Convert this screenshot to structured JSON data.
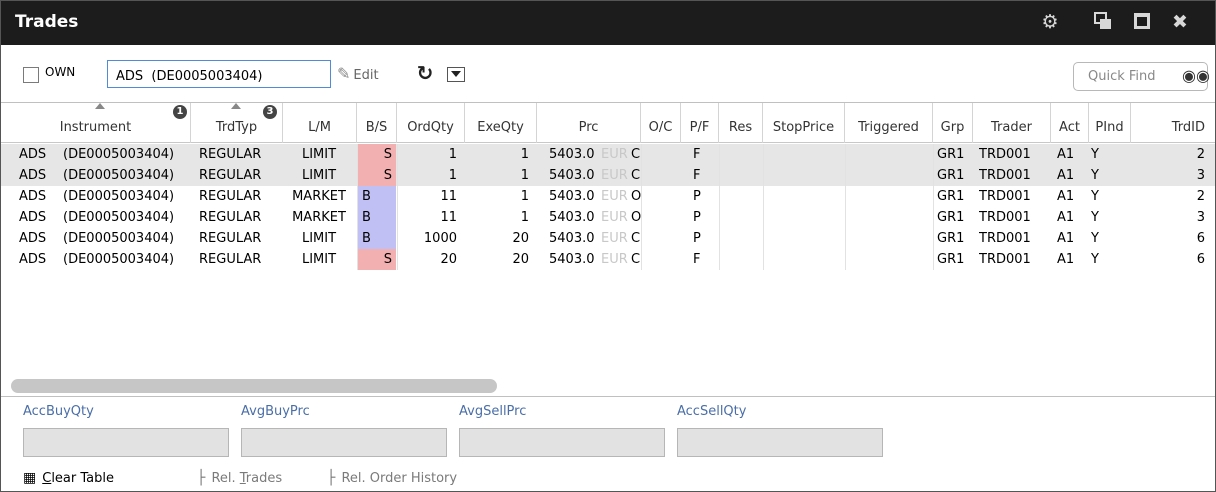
{
  "window": {
    "title": "Trades",
    "icons": [
      "gear-icon",
      "detach-icon",
      "maximize-icon",
      "close-icon"
    ]
  },
  "toolbar": {
    "own_label": "OWN",
    "own_checked": false,
    "instrument_value": "ADS  (DE0005003404)",
    "edit_label": "Edit",
    "quickfind_placeholder": "Quick Find"
  },
  "columns": [
    {
      "label": "Instrument",
      "sort": "asc",
      "sort_order": "1"
    },
    {
      "label": "TrdTyp",
      "sort": "asc",
      "sort_order": "3"
    },
    {
      "label": "L/M"
    },
    {
      "label": "B/S"
    },
    {
      "label": "OrdQty"
    },
    {
      "label": "ExeQty"
    },
    {
      "label": "Prc"
    },
    {
      "label": "O/C"
    },
    {
      "label": "P/F"
    },
    {
      "label": "Res"
    },
    {
      "label": "StopPrice"
    },
    {
      "label": "Triggered"
    },
    {
      "label": "Grp"
    },
    {
      "label": "Trader"
    },
    {
      "label": "Act"
    },
    {
      "label": "PInd"
    },
    {
      "label": "TrdID"
    }
  ],
  "rows": [
    {
      "instrument_sym": "ADS",
      "instrument_isin": "(DE0005003404)",
      "trdtyp": "REGULAR",
      "lm": "LIMIT",
      "bs": "S",
      "ordqty": "1",
      "exeqty": "1",
      "prc": "5403.0",
      "ccy": "EUR",
      "oc": "C",
      "pf": "F",
      "res": "",
      "stopprice": "",
      "triggered": "",
      "grp": "GR1",
      "trader": "TRD001",
      "act": "A1",
      "pind": "Y",
      "trdid": "2"
    },
    {
      "instrument_sym": "ADS",
      "instrument_isin": "(DE0005003404)",
      "trdtyp": "REGULAR",
      "lm": "LIMIT",
      "bs": "S",
      "ordqty": "1",
      "exeqty": "1",
      "prc": "5403.0",
      "ccy": "EUR",
      "oc": "C",
      "pf": "F",
      "res": "",
      "stopprice": "",
      "triggered": "",
      "grp": "GR1",
      "trader": "TRD001",
      "act": "A1",
      "pind": "Y",
      "trdid": "3"
    },
    {
      "instrument_sym": "ADS",
      "instrument_isin": "(DE0005003404)",
      "trdtyp": "REGULAR",
      "lm": "MARKET",
      "bs": "B",
      "ordqty": "11",
      "exeqty": "1",
      "prc": "5403.0",
      "ccy": "EUR",
      "oc": "O",
      "pf": "P",
      "res": "",
      "stopprice": "",
      "triggered": "",
      "grp": "GR1",
      "trader": "TRD001",
      "act": "A1",
      "pind": "Y",
      "trdid": "2"
    },
    {
      "instrument_sym": "ADS",
      "instrument_isin": "(DE0005003404)",
      "trdtyp": "REGULAR",
      "lm": "MARKET",
      "bs": "B",
      "ordqty": "11",
      "exeqty": "1",
      "prc": "5403.0",
      "ccy": "EUR",
      "oc": "O",
      "pf": "P",
      "res": "",
      "stopprice": "",
      "triggered": "",
      "grp": "GR1",
      "trader": "TRD001",
      "act": "A1",
      "pind": "Y",
      "trdid": "3"
    },
    {
      "instrument_sym": "ADS",
      "instrument_isin": "(DE0005003404)",
      "trdtyp": "REGULAR",
      "lm": "LIMIT",
      "bs": "B",
      "ordqty": "1000",
      "exeqty": "20",
      "prc": "5403.0",
      "ccy": "EUR",
      "oc": "C",
      "pf": "P",
      "res": "",
      "stopprice": "",
      "triggered": "",
      "grp": "GR1",
      "trader": "TRD001",
      "act": "A1",
      "pind": "Y",
      "trdid": "6"
    },
    {
      "instrument_sym": "ADS",
      "instrument_isin": "(DE0005003404)",
      "trdtyp": "REGULAR",
      "lm": "LIMIT",
      "bs": "S",
      "ordqty": "20",
      "exeqty": "20",
      "prc": "5403.0",
      "ccy": "EUR",
      "oc": "C",
      "pf": "F",
      "res": "",
      "stopprice": "",
      "triggered": "",
      "grp": "GR1",
      "trader": "TRD001",
      "act": "A1",
      "pind": "Y",
      "trdid": "6"
    }
  ],
  "summary": {
    "acc_buy_qty_label": "AccBuyQty",
    "avg_buy_prc_label": "AvgBuyPrc",
    "avg_sell_prc_label": "AvgSellPrc",
    "acc_sell_qty_label": "AccSellQty",
    "acc_buy_qty": "",
    "avg_buy_prc": "",
    "avg_sell_prc": "",
    "acc_sell_qty": ""
  },
  "actions": {
    "clear_table_prefix": "",
    "clear_table_ul": "C",
    "clear_table_rest": "lear Table",
    "rel_trades_prefix": "Rel. ",
    "rel_trades_ul": "T",
    "rel_trades_rest": "rades",
    "rel_order_history": "Rel. Order History"
  },
  "colors": {
    "titlebar": "#1c1c1c",
    "sell": "#f3b0b0",
    "buy": "#c0c0f4",
    "label_blue": "#4a6ea8",
    "input_border": "#4f8bd6"
  }
}
